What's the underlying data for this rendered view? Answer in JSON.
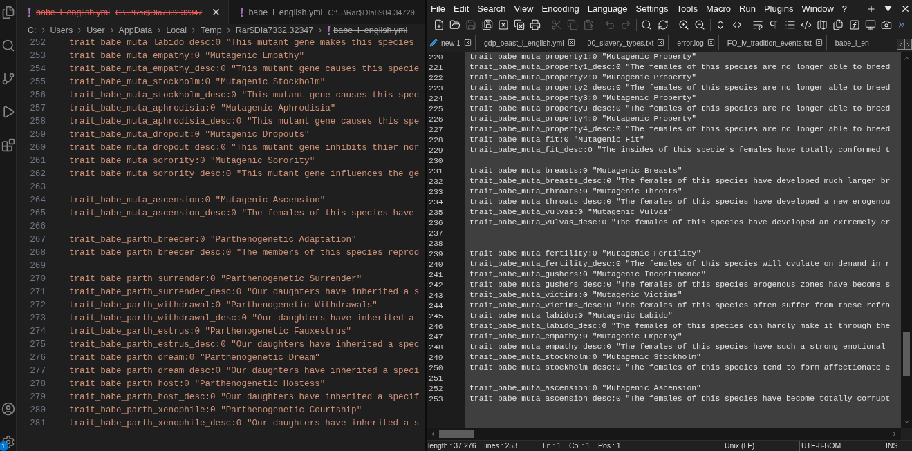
{
  "vscode": {
    "activity_badge": "1",
    "tabs": [
      {
        "name": "babe_l_english.yml",
        "path": "C:\\...\\Rar$DIa7332.32347",
        "selected": true,
        "deleted": true
      },
      {
        "name": "babe_l_english.yml",
        "path": "C:\\...\\Rar$DIa8984.34729",
        "selected": false,
        "deleted": false
      }
    ],
    "breadcrumb": {
      "folders": [
        "C:",
        "Users",
        "User",
        "AppData",
        "Local",
        "Temp",
        "Rar$DIa7332.32347"
      ],
      "file": {
        "name": "babe_l_english.yml",
        "deleted": true
      }
    },
    "lines": [
      {
        "number": "252",
        "text": "trait_babe_muta_labido_desc:0 \"This mutant gene makes this species"
      },
      {
        "number": "253",
        "text": "trait_babe_muta_empathy:0 \"Mutagenic Empathy\""
      },
      {
        "number": "254",
        "text": "trait_babe_muta_empathy_desc:0 \"This mutant gene causes this specie"
      },
      {
        "number": "255",
        "text": "trait_babe_muta_stockholm:0 \"Mutagenic Stockholm\""
      },
      {
        "number": "256",
        "text": "trait_babe_muta_stockholm_desc:0 \"This mutant gene causes this spec"
      },
      {
        "number": "257",
        "text": "trait_babe_muta_aphrodisia:0 \"Mutagenic Aphrodisia\""
      },
      {
        "number": "258",
        "text": "trait_babe_muta_aphrodisia_desc:0 \"This mutant gene causes this spe"
      },
      {
        "number": "259",
        "text": "trait_babe_muta_dropout:0 \"Mutagenic Dropouts\""
      },
      {
        "number": "260",
        "text": "trait_babe_muta_dropout_desc:0 \"This mutant gene inhibits thier nor"
      },
      {
        "number": "261",
        "text": "trait_babe_muta_sorority:0 \"Mutagenic Sorority\""
      },
      {
        "number": "262",
        "text": "trait_babe_muta_sorority_desc:0 \"This mutant gene influences the ge"
      },
      {
        "number": "263"
      },
      {
        "number": "264",
        "text": "trait_babe_muta_ascension:0 \"Mutagenic Ascension\""
      },
      {
        "number": "265",
        "text": "trait_babe_muta_ascension_desc:0 \"The females of this species have"
      },
      {
        "number": "266"
      },
      {
        "number": "267",
        "text": "trait_babe_parth_breeder:0 \"Parthenogenetic Adaptation\""
      },
      {
        "number": "268",
        "text": "trait_babe_parth_breeder_desc:0 \"The members of this species reprod"
      },
      {
        "number": "269"
      },
      {
        "number": "270",
        "text": "trait_babe_parth_surrender:0 \"Parthenogenetic Surrender\""
      },
      {
        "number": "271",
        "text": "trait_babe_parth_surrender_desc:0 \"Our daughters have inherited a s"
      },
      {
        "number": "272",
        "text": "trait_babe_parth_withdrawal:0 \"Parthenogenetic Withdrawals\""
      },
      {
        "number": "273",
        "text": "trait_babe_parth_withdrawal_desc:0 \"Our daughters have inherited a"
      },
      {
        "number": "274",
        "text": "trait_babe_parth_estrus:0 \"Parthenogenetic Fauxestrus\""
      },
      {
        "number": "275",
        "text": "trait_babe_parth_estrus_desc:0 \"Our daughters have inherited a spec"
      },
      {
        "number": "276",
        "text": "trait_babe_parth_dream:0 \"Parthenogenetic Dream\""
      },
      {
        "number": "277",
        "text": "trait_babe_parth_dream_desc:0 \"Our daughters have inherited a speci"
      },
      {
        "number": "278",
        "text": "trait_babe_parth_host:0 \"Parthenogenetic Hostess\""
      },
      {
        "number": "279",
        "text": "trait_babe_parth_host_desc:0 \"Our daughters have inherited a specif"
      },
      {
        "number": "280",
        "text": "trait_babe_parth_xenophile:0 \"Parthenogenetic Courtship\""
      },
      {
        "number": "281",
        "text": "trait_babe_parth_xenophile_desc:0 \"Our daughters have inherited a s"
      }
    ]
  },
  "notepad": {
    "menu": [
      "File",
      "Edit",
      "Search",
      "View",
      "Encoding",
      "Language",
      "Settings",
      "Tools",
      "Macro",
      "Run",
      "Plugins",
      "Window",
      "?"
    ],
    "toolbar": [
      {
        "disabled": false
      },
      {
        "disabled": false
      },
      {
        "disabled": true
      },
      {
        "disabled": false
      },
      {
        "disabled": false
      },
      {
        "disabled": false
      },
      {
        "disabled": false
      },
      {
        "disabled": true
      },
      {
        "disabled": true
      },
      {
        "disabled": true
      },
      {
        "disabled": true
      },
      {
        "disabled": true
      },
      {
        "disabled": false
      },
      {
        "disabled": false
      },
      {
        "disabled": false
      },
      {
        "disabled": false
      },
      {
        "disabled": false
      },
      {
        "disabled": false
      },
      {
        "disabled": false
      },
      {
        "disabled": false
      },
      {
        "disabled": false
      },
      {
        "disabled": false
      },
      {
        "disabled": false
      },
      {
        "disabled": false
      },
      {
        "disabled": false
      },
      {
        "disabled": false
      },
      {
        "disabled": false
      }
    ],
    "tabs": [
      {
        "label": "new 1",
        "kind": "untitled",
        "selected": false
      },
      {
        "label": "gdp_beast_l_english.yml",
        "kind": "file",
        "selected": false
      },
      {
        "label": "00_slavery_types.txt",
        "kind": "file",
        "selected": false
      },
      {
        "label": "error.log",
        "kind": "file",
        "selected": false
      },
      {
        "label": "FO_lv_tradition_events.txt",
        "kind": "file",
        "selected": false
      },
      {
        "label": "babe_l_en",
        "kind": "cut",
        "selected": false
      }
    ],
    "lines": [
      {
        "number": "220",
        "text": "trait_babe_muta_property1:0 \"Mutagenic Property\""
      },
      {
        "number": "221",
        "text": "trait_babe_muta_property1_desc:0 \"The females of this species are no longer able to breed"
      },
      {
        "number": "222",
        "text": "trait_babe_muta_property2:0 \"Mutagenic Property\""
      },
      {
        "number": "223",
        "text": "trait_babe_muta_property2_desc:0 \"The females of this species are no longer able to breed"
      },
      {
        "number": "224",
        "text": "trait_babe_muta_property3:0 \"Mutagenic Property\""
      },
      {
        "number": "225",
        "text": "trait_babe_muta_property3_desc:0 \"The females of this species are no longer able to breed"
      },
      {
        "number": "226",
        "text": "trait_babe_muta_property4:0 \"Mutagenic Property\""
      },
      {
        "number": "227",
        "text": "trait_babe_muta_property4_desc:0 \"The females of this species are no longer able to breed"
      },
      {
        "number": "228",
        "text": "trait_babe_muta_fit:0 \"Mutagenic Fit\""
      },
      {
        "number": "229",
        "text": "trait_babe_muta_fit_desc:0 \"The insides of this specie's females have totally conformed t"
      },
      {
        "number": "230"
      },
      {
        "number": "231",
        "text": "trait_babe_muta_breasts:0 \"Mutagenic Breasts\""
      },
      {
        "number": "232",
        "text": "trait_babe_muta_breasts_desc:0 \"The females of this species have developed much larger br"
      },
      {
        "number": "233",
        "text": "trait_babe_muta_throats:0 \"Mutagenic Throats\""
      },
      {
        "number": "234",
        "text": "trait_babe_muta_throats_desc:0 \"The females of this species have developed a new erogenou"
      },
      {
        "number": "235",
        "text": "trait_babe_muta_vulvas:0 \"Mutagenic Vulvas\""
      },
      {
        "number": "236",
        "text": "trait_babe_muta_vulvas_desc:0 \"The females of this species have developed an extremely er"
      },
      {
        "number": "237"
      },
      {
        "number": "238"
      },
      {
        "number": "239",
        "text": "trait_babe_muta_fertility:0 \"Mutagenic Fertility\""
      },
      {
        "number": "240",
        "text": "trait_babe_muta_fertility_desc:0 \"The females of this species will ovulate on demand in r"
      },
      {
        "number": "241",
        "text": "trait_babe_muta_gushers:0 \"Mutagenic Incontinence\""
      },
      {
        "number": "242",
        "text": "trait_babe_muta_gushers_desc:0 \"The females of this species erogenous zones have become s"
      },
      {
        "number": "243",
        "text": "trait_babe_muta_victims:0 \"Mutagenic Victims\""
      },
      {
        "number": "244",
        "text": "trait_babe_muta_victims_desc:0 \"The females of this species often suffer from these refra"
      },
      {
        "number": "245",
        "text": "trait_babe_muta_labido:0 \"Mutagenic Labido\""
      },
      {
        "number": "246",
        "text": "trait_babe_muta_labido_desc:0 \"The females of this species can hardly make it through the"
      },
      {
        "number": "247",
        "text": "trait_babe_muta_empathy:0 \"Mutagenic Empathy\""
      },
      {
        "number": "248",
        "text": "trait_babe_muta_empathy_desc:0 \"The females of this species have such a strong emotional"
      },
      {
        "number": "249",
        "text": "trait_babe_muta_stockholm:0 \"Mutagenic Stockholm\""
      },
      {
        "number": "250",
        "text": "trait_babe_muta_stockholm_desc:0 \"The females of this species tend to form affectionate e"
      },
      {
        "number": "251"
      },
      {
        "number": "252",
        "text": "trait_babe_muta_ascension:0 \"Mutagenic Ascension\""
      },
      {
        "number": "253",
        "text": "trait_babe_muta_ascension_desc:0 \"The females of this species have become totally corrupt"
      }
    ],
    "status_bar": [
      "length : 37,276    lines : 253",
      "Ln : 1    Col : 1    Pos : 1",
      "Unix (LF)",
      "UTF-8-BOM",
      "INS"
    ]
  }
}
